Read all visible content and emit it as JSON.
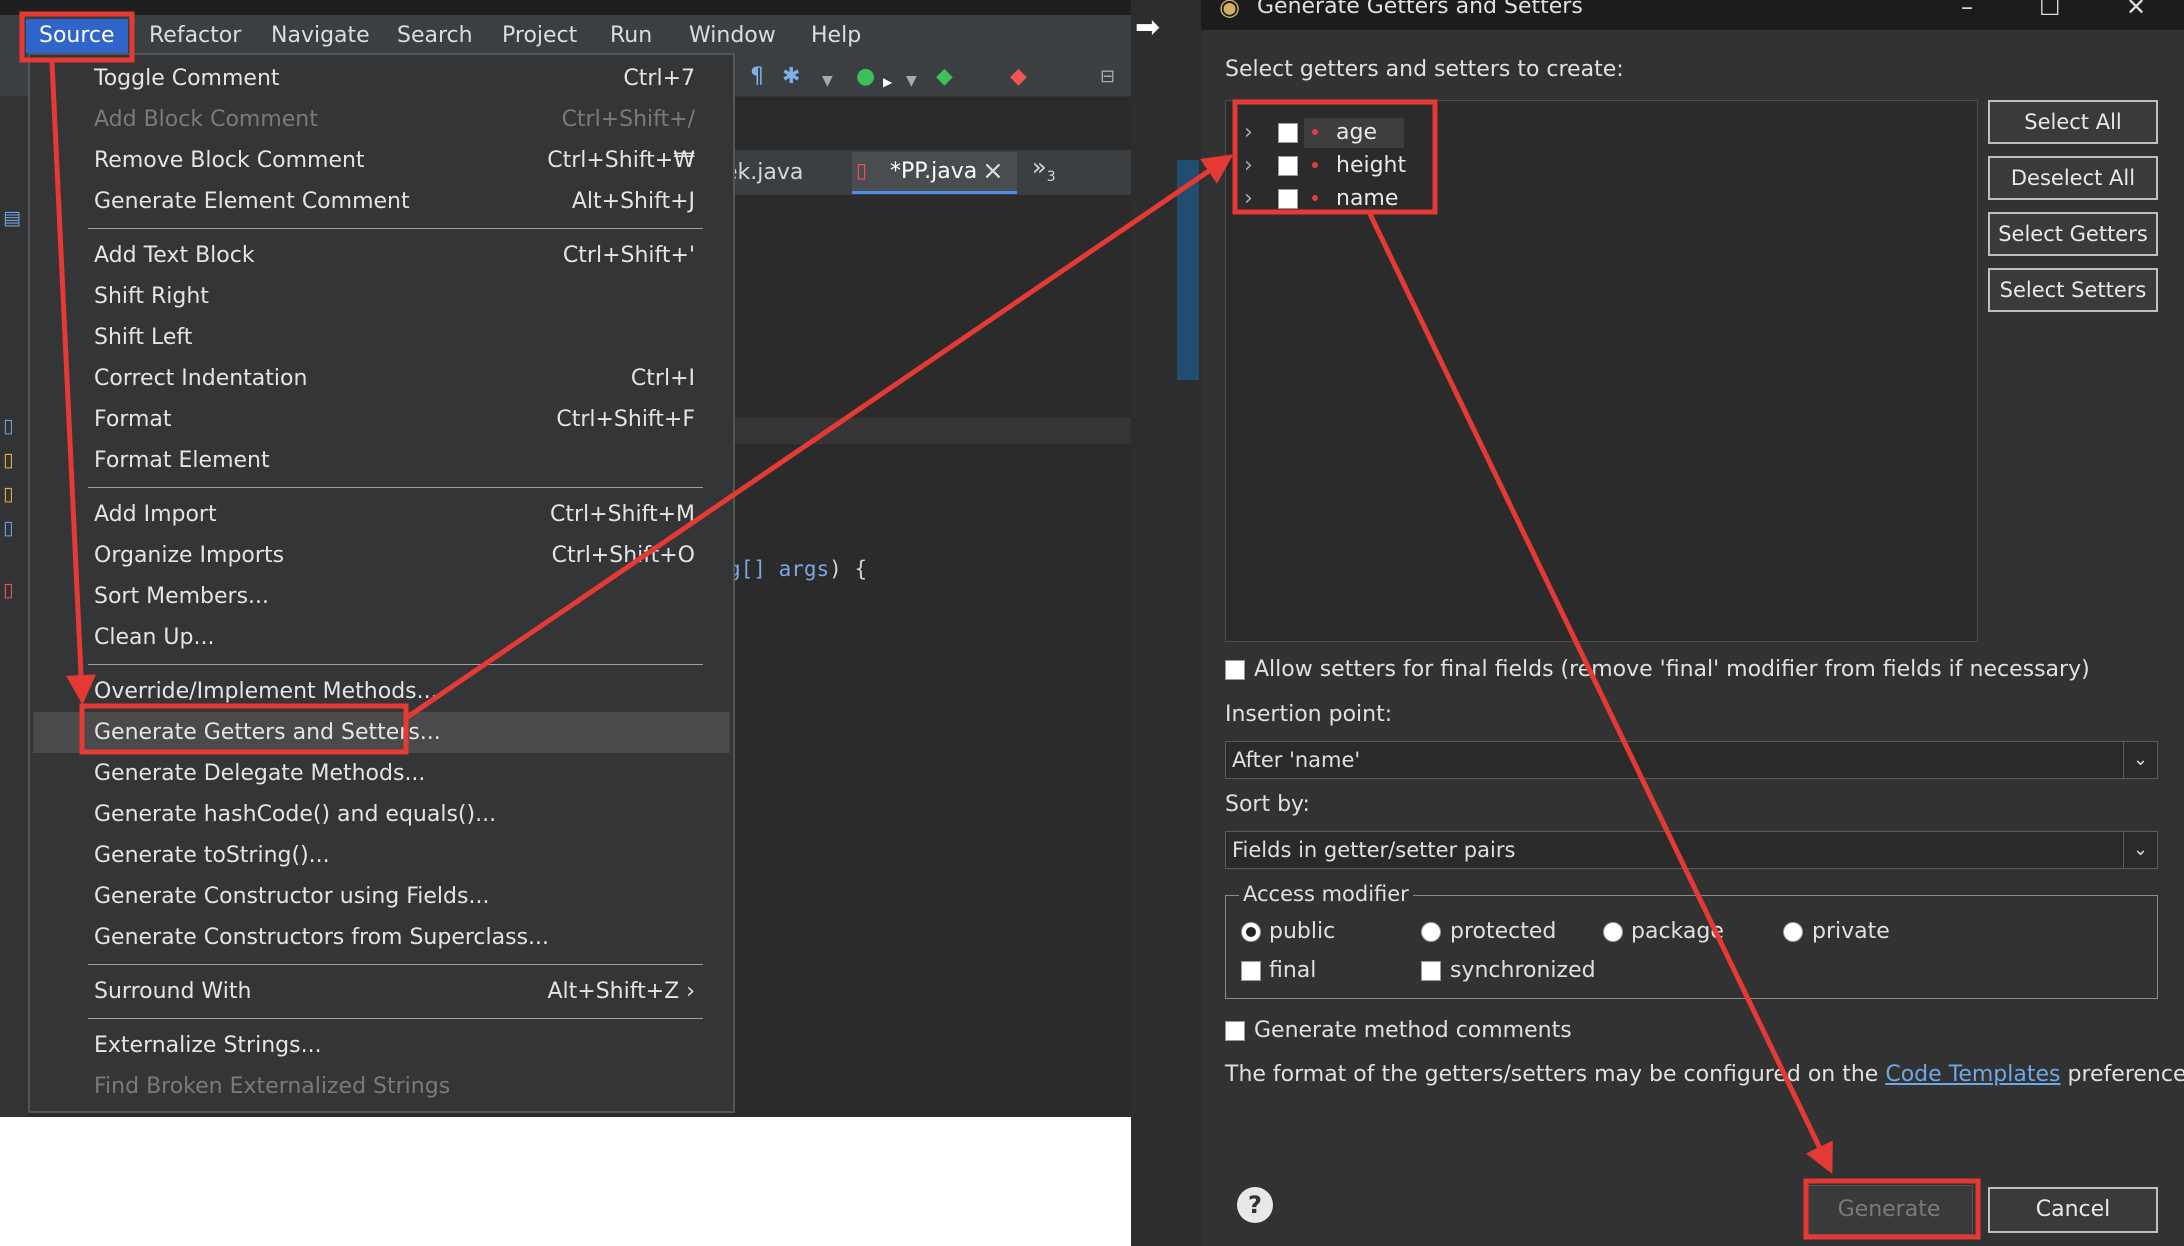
{
  "menubar": {
    "items": [
      "Source",
      "Refactor",
      "Navigate",
      "Search",
      "Project",
      "Run",
      "Window",
      "Help"
    ]
  },
  "editor": {
    "tabs": [
      "ek.java",
      "*PP.java"
    ],
    "overflow_label": "»",
    "overflow_count": "3",
    "code_line": {
      "before": "g[] ",
      "param": "args",
      "after": ") {"
    }
  },
  "source_menu": {
    "items": [
      {
        "label": "Toggle Comment",
        "shortcut": "Ctrl+7",
        "disabled": false
      },
      {
        "label": "Add Block Comment",
        "shortcut": "Ctrl+Shift+/",
        "disabled": true
      },
      {
        "label": "Remove Block Comment",
        "shortcut": "Ctrl+Shift+₩",
        "disabled": false
      },
      {
        "label": "Generate Element Comment",
        "shortcut": "Alt+Shift+J",
        "disabled": false
      },
      {
        "label": "Add Text Block",
        "shortcut": "Ctrl+Shift+'",
        "disabled": false
      },
      {
        "label": "Shift Right",
        "shortcut": "",
        "disabled": false
      },
      {
        "label": "Shift Left",
        "shortcut": "",
        "disabled": false
      },
      {
        "label": "Correct Indentation",
        "shortcut": "Ctrl+I",
        "disabled": false
      },
      {
        "label": "Format",
        "shortcut": "Ctrl+Shift+F",
        "disabled": false
      },
      {
        "label": "Format Element",
        "shortcut": "",
        "disabled": false
      },
      {
        "label": "Add Import",
        "shortcut": "Ctrl+Shift+M",
        "disabled": false
      },
      {
        "label": "Organize Imports",
        "shortcut": "Ctrl+Shift+O",
        "disabled": false
      },
      {
        "label": "Sort Members...",
        "shortcut": "",
        "disabled": false
      },
      {
        "label": "Clean Up...",
        "shortcut": "",
        "disabled": false
      },
      {
        "label": "Override/Implement Methods...",
        "shortcut": "",
        "disabled": false
      },
      {
        "label": "Generate Getters and Setters...",
        "shortcut": "",
        "disabled": false
      },
      {
        "label": "Generate Delegate Methods...",
        "shortcut": "",
        "disabled": false
      },
      {
        "label": "Generate hashCode() and equals()...",
        "shortcut": "",
        "disabled": false
      },
      {
        "label": "Generate toString()...",
        "shortcut": "",
        "disabled": false
      },
      {
        "label": "Generate Constructor using Fields...",
        "shortcut": "",
        "disabled": false
      },
      {
        "label": "Generate Constructors from Superclass...",
        "shortcut": "",
        "disabled": false
      },
      {
        "label": "Surround With",
        "shortcut": "Alt+Shift+Z ›",
        "disabled": false
      },
      {
        "label": "Externalize Strings...",
        "shortcut": "",
        "disabled": false
      },
      {
        "label": "Find Broken Externalized Strings",
        "shortcut": "",
        "disabled": true
      }
    ]
  },
  "dialog": {
    "title": "Generate Getters and Setters",
    "select_label": "Select getters and setters to create:",
    "fields": [
      "age",
      "height",
      "name"
    ],
    "buttons": {
      "select_all": "Select All",
      "deselect_all": "Deselect All",
      "select_getters": "Select Getters",
      "select_setters": "Select Setters"
    },
    "allow_setters_final": "Allow setters for final fields (remove 'final' modifier from fields if necessary)",
    "insertion_point_label": "Insertion point:",
    "insertion_point_value": "After 'name'",
    "sort_by_label": "Sort by:",
    "sort_by_value": "Fields in getter/setter pairs",
    "access_modifier": {
      "legend": "Access modifier",
      "options": [
        "public",
        "protected",
        "package",
        "private"
      ],
      "selected": "public",
      "checks": [
        "final",
        "synchronized"
      ]
    },
    "generate_comments": "Generate method comments",
    "format_note": {
      "before": "The format of the getters/setters may be configured on the ",
      "link": "Code Templates",
      "after": " preference page."
    },
    "help_glyph": "?",
    "generate_label": "Generate",
    "cancel_label": "Cancel"
  },
  "colors": {
    "annotation": "#e53935",
    "menu_active": "#2f65ca",
    "link": "#6fa8e6"
  }
}
